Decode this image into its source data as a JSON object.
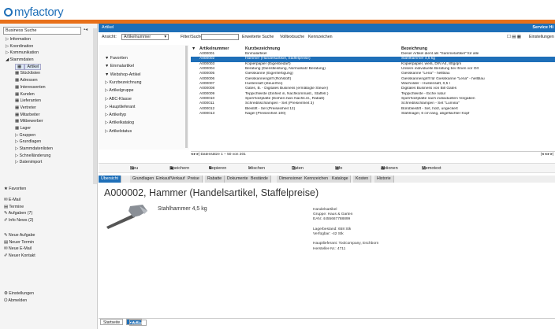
{
  "brand": {
    "name": "myfactory",
    "accent": "#1e6fb8",
    "orange": "#e8701a"
  },
  "sidebar": {
    "search_placeholder": "Business Suche",
    "tree": [
      {
        "label": "Information",
        "icon": "triangle-right-icon",
        "indent": 1
      },
      {
        "label": "Koordination",
        "icon": "triangle-right-icon",
        "indent": 1
      },
      {
        "label": "Kommunikation",
        "icon": "triangle-right-icon",
        "indent": 1
      },
      {
        "label": "Stammdaten",
        "icon": "triangle-down-icon",
        "indent": 1
      },
      {
        "label": "Artikel",
        "icon": "table-icon",
        "indent": 2,
        "selected": true
      },
      {
        "label": "Stücklisten",
        "icon": "table-icon",
        "indent": 2
      },
      {
        "label": "Adressen",
        "icon": "table-icon",
        "indent": 2
      },
      {
        "label": "Interessenten",
        "icon": "table-icon",
        "indent": 2
      },
      {
        "label": "Kunden",
        "icon": "table-icon",
        "indent": 2
      },
      {
        "label": "Lieferanten",
        "icon": "table-icon",
        "indent": 2
      },
      {
        "label": "Vertreter",
        "icon": "table-icon",
        "indent": 2
      },
      {
        "label": "Mitarbeiter",
        "icon": "table-icon",
        "indent": 2
      },
      {
        "label": "Mitbewerber",
        "icon": "table-icon",
        "indent": 2
      },
      {
        "label": "Lager",
        "icon": "table-icon",
        "indent": 2
      },
      {
        "label": "Gruppen",
        "icon": "triangle-right-icon",
        "indent": 2
      },
      {
        "label": "Grundlagen",
        "icon": "triangle-right-icon",
        "indent": 2
      },
      {
        "label": "Stammdatenlisten",
        "icon": "triangle-right-icon",
        "indent": 2
      },
      {
        "label": "Schnelländerung",
        "icon": "triangle-right-icon",
        "indent": 2
      },
      {
        "label": "Datenimport",
        "icon": "triangle-right-icon",
        "indent": 2
      }
    ],
    "favoriten": "Favoriten",
    "links1": [
      "E-Mail",
      "Termine",
      "Aufgaben (7)",
      "Info News (2)"
    ],
    "links2": [
      "Neue Aufgabe",
      "Neuer Termin",
      "Neue E-Mail",
      "Neuer Kontakt"
    ],
    "links3": [
      "Einstellungen",
      "Abmelden"
    ]
  },
  "main": {
    "title": "Artikel",
    "title_right": "Service  Hi",
    "ansicht_label": "Ansicht:",
    "ansicht_value": "Artikelnummer",
    "filter_label": "Filter/Suche:",
    "filter_options": [
      "Erweiterte Suche",
      "Volltextsuche",
      "Kennzeichen"
    ],
    "settings": "Einstellungen",
    "filters": [
      "Favoriten",
      "Einmalartikel",
      "Webshop-Artikel",
      "Kurzbezeichnung",
      "Artikelgruppe",
      "ABC-Klasse",
      "Hauptlieferant",
      "Artikeltyp",
      "Artikelkatalog",
      "Artikelstatus"
    ],
    "grid": {
      "columns": [
        "Artikelnummer",
        "Kurzbezeichnung",
        "Bezeichnung"
      ],
      "rows": [
        [
          "A000001",
          "Einmalartikel",
          "Dieser Artikel dient als \"Sammelartikel\" für alle"
        ],
        [
          "A000002",
          "Hammer (Handelsartikel, Staffelpreise)",
          "Stahlhammer 4,5 kg"
        ],
        [
          "A000003",
          "Kopierpapier (Eigenbedarf)",
          "Kopierpapier, weiß, DIN A4, 80g/qm"
        ],
        [
          "A000004",
          "Beratung (Dienstleistung, Normalsatz Beratung)",
          "Unsere individuelle Beratung bei Ihnen vor Ort"
        ],
        [
          "A000005",
          "Giesskanne (Eigenfertigung)",
          "Giesskanne \"Lena\" - hellblau"
        ],
        [
          "A000006",
          "Giesskannengriff (Rohstoff)",
          "Giesskannengriff für Giesskanne \"Lena\" - hellblau"
        ],
        [
          "A000007",
          "Hustensaft (steuerfrei)",
          "Wacholder - Hustensaft, 0,5 l"
        ],
        [
          "A000008",
          "Gates, B. - Digitales Business (ermäßigte Steuer)",
          "Digitales Business von Bill Gates"
        ],
        [
          "A000009",
          "Teppichleiste (Einheit in, Nachkommast., Staffelr.)",
          "Teppichleiste - Eiche natur"
        ],
        [
          "A000010",
          "Sperrholzplatte (Einheit zwei Nachk.st., Rabatt)",
          "Sperrholzplatte nach individuellen Vorgaben"
        ],
        [
          "A000011",
          "Schreibtischlampen - Set (Preiseinheit 3)",
          "Schreibtischlampen - Set \"Lumina\""
        ],
        [
          "A000012",
          "Bleistift - Set (Preiseinheit 12)",
          "Bürobleistift - Set, holz, ungeckert"
        ],
        [
          "A000013",
          "Nagel (Preiseinheit 100)",
          "Stahlnagel, 6 cm lang, abgeflachter Kopf"
        ]
      ],
      "selected_index": 1,
      "footer": "Datensätze 1 – 50 von 201"
    },
    "actions": [
      "Neu",
      "Speichern",
      "Kopieren",
      "Löschen",
      "Daten",
      "Info",
      "Aktionen",
      "Memotext"
    ],
    "tabs": [
      "Übersicht",
      "Grundlagen",
      "Einkauf/Verkauf",
      "Preise",
      "Rabatte",
      "Dokumente",
      "Bestände",
      "Dimensionen",
      "Kennzeichen",
      "Kataloge",
      "Kosten",
      "Historie"
    ],
    "detail": {
      "title": "A000002, Hammer (Handelsartikel, Staffelpreise)",
      "short": "Stahlhammer 4,5 kg",
      "info": [
        "Handelsartikel",
        "Gruppe: Haus & Garten",
        "EAN: 4455667788899",
        "",
        "Lagerbestand: 658 Stk",
        "Verfügbar: -42 Stk",
        "",
        "Hauptlieferant: Toolcompany, Eschborn",
        "Hersteller-Nr.: 4711"
      ]
    },
    "bottom_tabs": [
      "Startseite",
      "Artikel"
    ]
  }
}
